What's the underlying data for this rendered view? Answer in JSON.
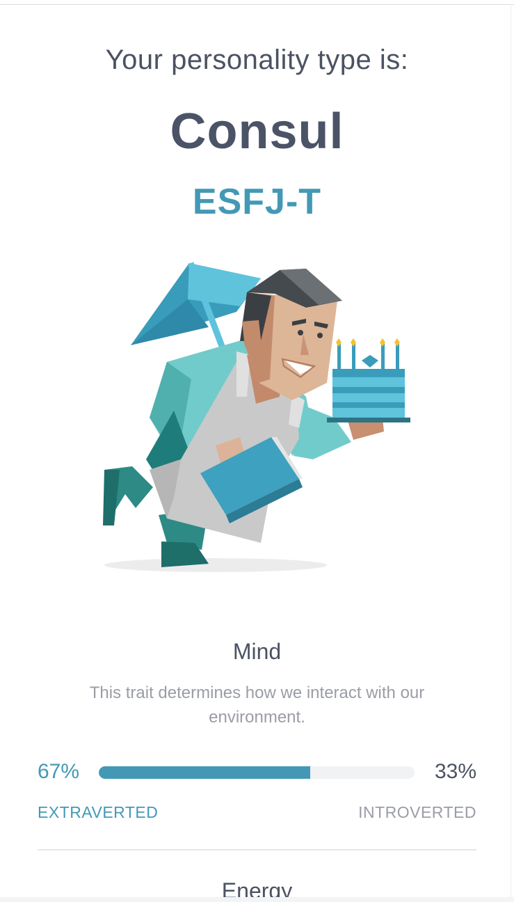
{
  "header": {
    "intro": "Your personality type is:",
    "type_name": "Consul",
    "type_code": "ESFJ-T"
  },
  "illustration": {
    "icon": "consul-character-illustration"
  },
  "trait": {
    "title": "Mind",
    "description": "This trait determines how we interact with our environment.",
    "left_percent_label": "67%",
    "right_percent_label": "33%",
    "left_value": 67,
    "left_label": "EXTRAVERTED",
    "right_label": "INTROVERTED",
    "accent_color": "#4399b5"
  },
  "next_trait": {
    "title": "Energy"
  }
}
